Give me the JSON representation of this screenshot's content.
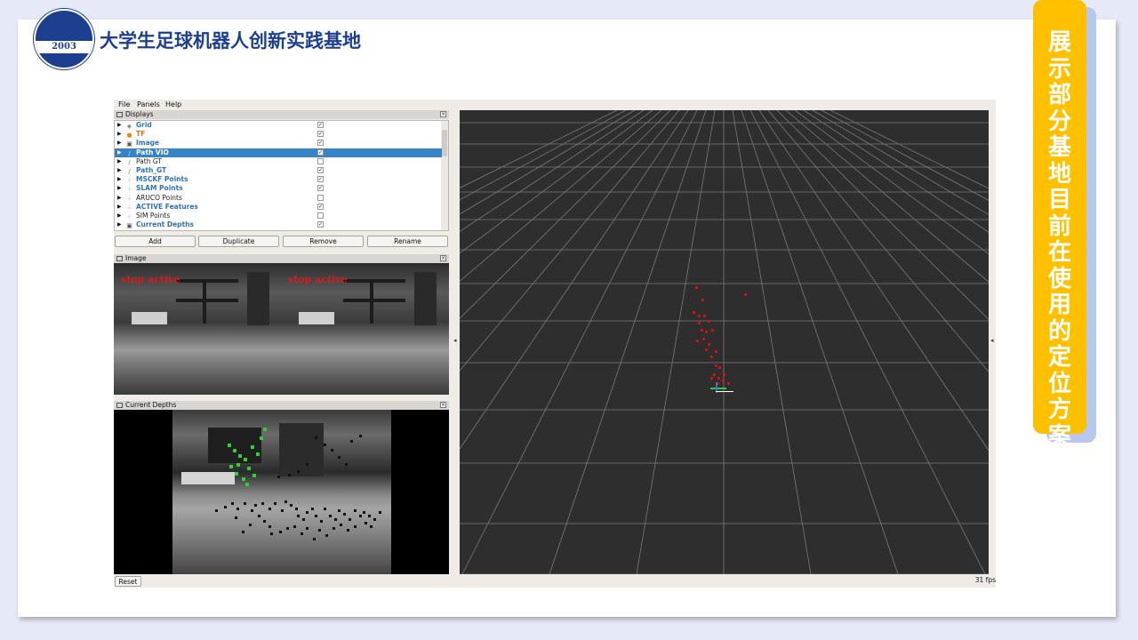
{
  "slide": {
    "site_title": "大学生足球机器人创新实践基地",
    "side_title": "展示部分基地目前在使用的定位方案",
    "logo_year": "2003"
  },
  "rviz": {
    "menu": [
      "File",
      "Panels",
      "Help"
    ],
    "displays_panel_title": "Displays",
    "displays": [
      {
        "name": "Grid",
        "icon": "grid-icon",
        "checked": true,
        "color": "#2f73b5"
      },
      {
        "name": "TF",
        "icon": "tf-icon",
        "checked": true,
        "color": "#c97a14"
      },
      {
        "name": "Image",
        "icon": "image-icon",
        "checked": true,
        "color": "#2f73b5"
      },
      {
        "name": "Path VIO",
        "icon": "path-icon",
        "checked": true,
        "color": "#ffffff",
        "selected": true
      },
      {
        "name": "Path GT",
        "icon": "path-icon",
        "checked": false,
        "color": "#222222"
      },
      {
        "name": "Path_GT",
        "icon": "path-icon",
        "checked": true,
        "color": "#2f73b5"
      },
      {
        "name": "MSCKF Points",
        "icon": "points-icon",
        "checked": true,
        "color": "#2f73b5"
      },
      {
        "name": "SLAM Points",
        "icon": "points-icon",
        "checked": true,
        "color": "#2f73b5"
      },
      {
        "name": "ARUCO Points",
        "icon": "points-icon",
        "checked": false,
        "color": "#222222"
      },
      {
        "name": "ACTIVE Features",
        "icon": "points-icon",
        "checked": true,
        "color": "#2f73b5"
      },
      {
        "name": "SIM Points",
        "icon": "points-icon",
        "checked": false,
        "color": "#222222"
      },
      {
        "name": "Current Depths",
        "icon": "image-icon",
        "checked": true,
        "color": "#2f73b5"
      }
    ],
    "buttons": {
      "add": "Add",
      "duplicate": "Duplicate",
      "remove": "Remove",
      "rename": "Rename"
    },
    "image_panel_title": "Image",
    "image_overlay_left": "stop active",
    "image_overlay_right": "stop active",
    "depth_panel_title": "Current Depths",
    "reset_label": "Reset",
    "fps": "31 fps",
    "close_glyph": "×",
    "colors": {
      "accent": "#ffc000",
      "brand": "#1d3f8f",
      "selection": "#3584c8",
      "feature_points": "#e01010"
    }
  }
}
